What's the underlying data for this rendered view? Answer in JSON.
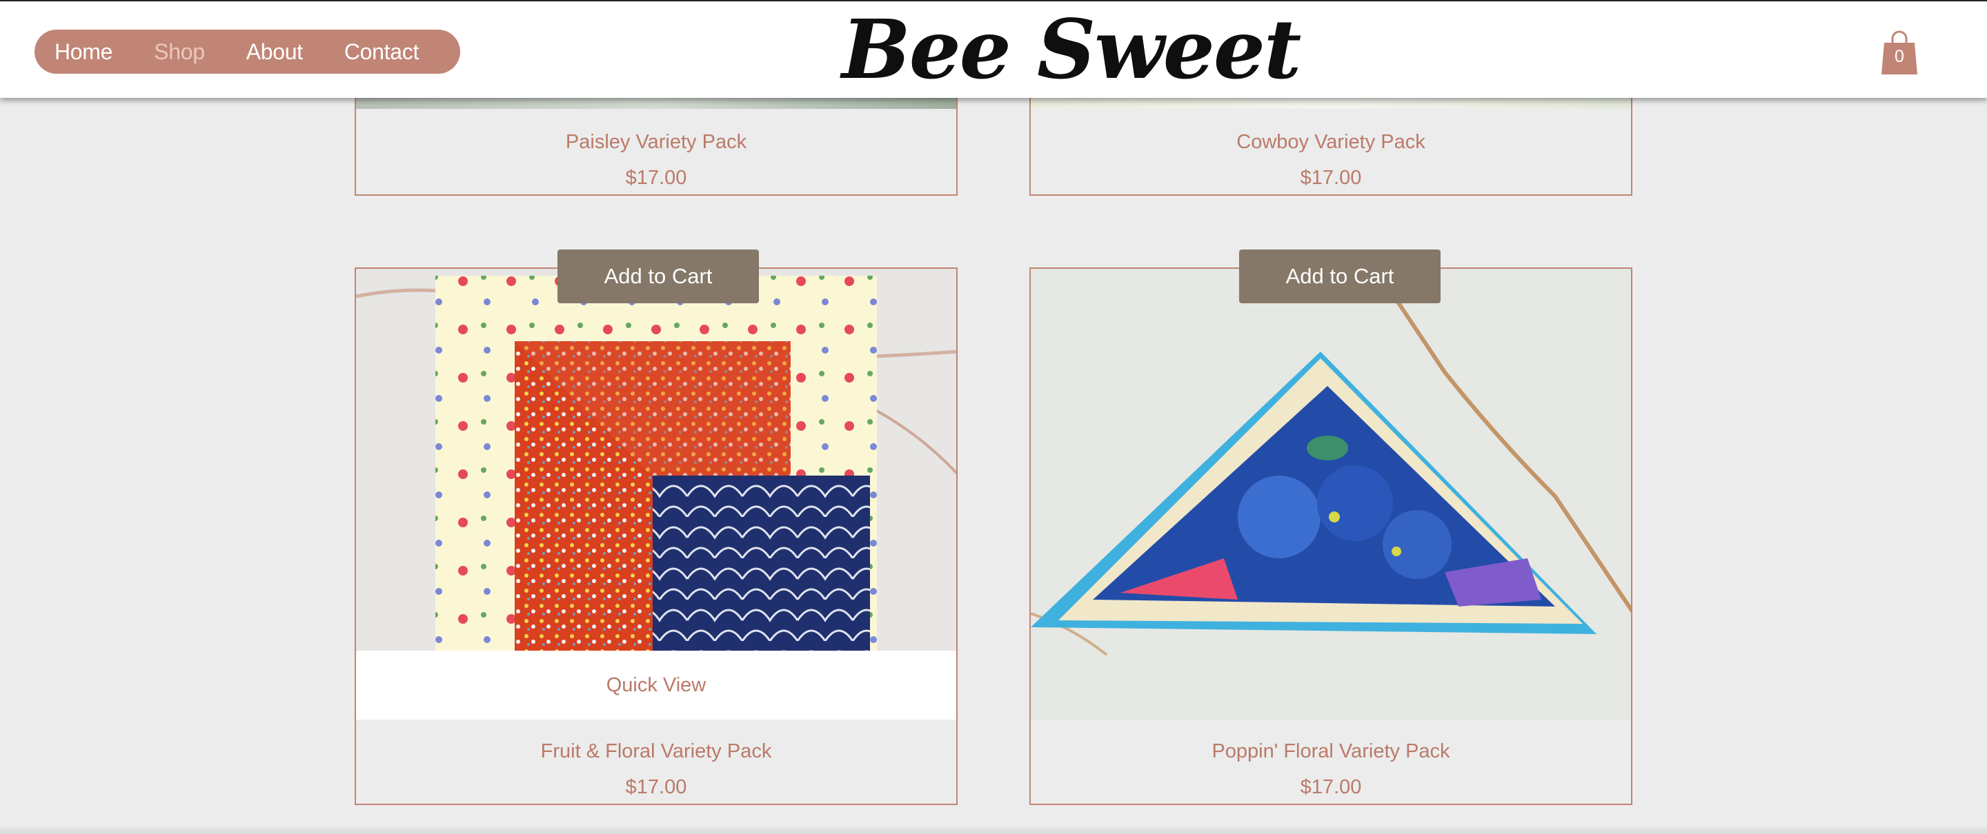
{
  "header": {
    "nav": [
      "Home",
      "Shop",
      "About",
      "Contact"
    ],
    "active": "Shop",
    "logo": "Bee Sweet",
    "cart_count": "0"
  },
  "products": [
    {
      "title": "Paisley Variety Pack",
      "price": "$17.00"
    },
    {
      "title": "Cowboy Variety Pack",
      "price": "$17.00"
    },
    {
      "title": "Fruit & Floral Variety Pack",
      "price": "$17.00",
      "quick_view": "Quick View",
      "button": "Add to Cart"
    },
    {
      "title": "Poppin' Floral Variety Pack",
      "price": "$17.00",
      "button": "Add to Cart"
    }
  ],
  "colors": {
    "accent": "#c08575",
    "button": "#857868",
    "text": "#bb7a68",
    "background": "#ececec"
  }
}
